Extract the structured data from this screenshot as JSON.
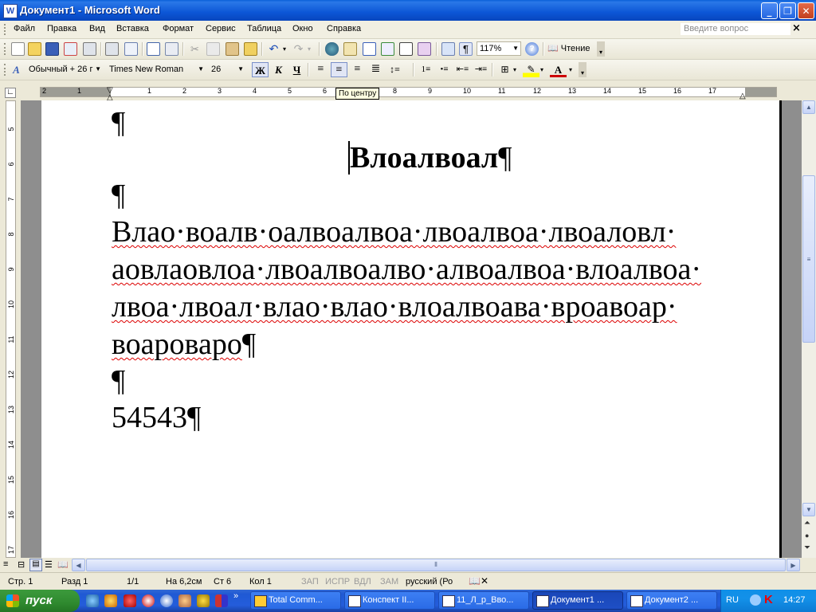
{
  "window": {
    "title": "Документ1 - Microsoft Word",
    "app_icon": "W"
  },
  "menu": {
    "items": [
      "Файл",
      "Правка",
      "Вид",
      "Вставка",
      "Формат",
      "Сервис",
      "Таблица",
      "Окно",
      "Справка"
    ],
    "ask_placeholder": "Введите вопрос"
  },
  "standard_toolbar": {
    "zoom": "117%",
    "reading_label": "Чтение"
  },
  "formatting_toolbar": {
    "style": "Обычный + 26 г",
    "font": "Times New Roman",
    "size": "26",
    "bold": "Ж",
    "italic": "К",
    "underline": "Ч",
    "font_color_letter": "А"
  },
  "ruler": {
    "tooltip": "По центру",
    "numbers": [
      "2",
      "1",
      "1",
      "2",
      "3",
      "4",
      "5",
      "6",
      "7",
      "8",
      "9",
      "10",
      "11",
      "12",
      "13",
      "14",
      "15",
      "16",
      "17"
    ],
    "vnumbers": [
      "5",
      "6",
      "7",
      "8",
      "9",
      "10",
      "11",
      "12",
      "13",
      "14",
      "15",
      "16",
      "17"
    ]
  },
  "document": {
    "title_line": "Влоалвоал",
    "body_lines": [
      "Влао·воалв·оалвоалвоа·лвоалвоа·лвоаловл·",
      "аовлаовлоа·лвоалвоалво·алвоалвоа·влоалвоа·",
      "лвоа·лвоал·влао·влао·влоалвоава·вроавоар·",
      "воароваро"
    ],
    "number_line": "54543",
    "pilcrow": "¶"
  },
  "status": {
    "page": "Стр. 1",
    "section": "Разд 1",
    "pages": "1/1",
    "position": "На 6,2см",
    "line": "Ст 6",
    "column": "Кол 1",
    "rec": "ЗАП",
    "trk": "ИСПР",
    "ext": "ВДЛ",
    "ovr": "ЗАМ",
    "language": "русский (Ро"
  },
  "taskbar": {
    "start_label": "пуск",
    "tasks": [
      "Total Comm...",
      "Конспект II...",
      "11_Л_р_Вво...",
      "Документ1 ...",
      "Документ2 ..."
    ],
    "active_task": 3,
    "language": "RU",
    "clock": "14:27"
  }
}
